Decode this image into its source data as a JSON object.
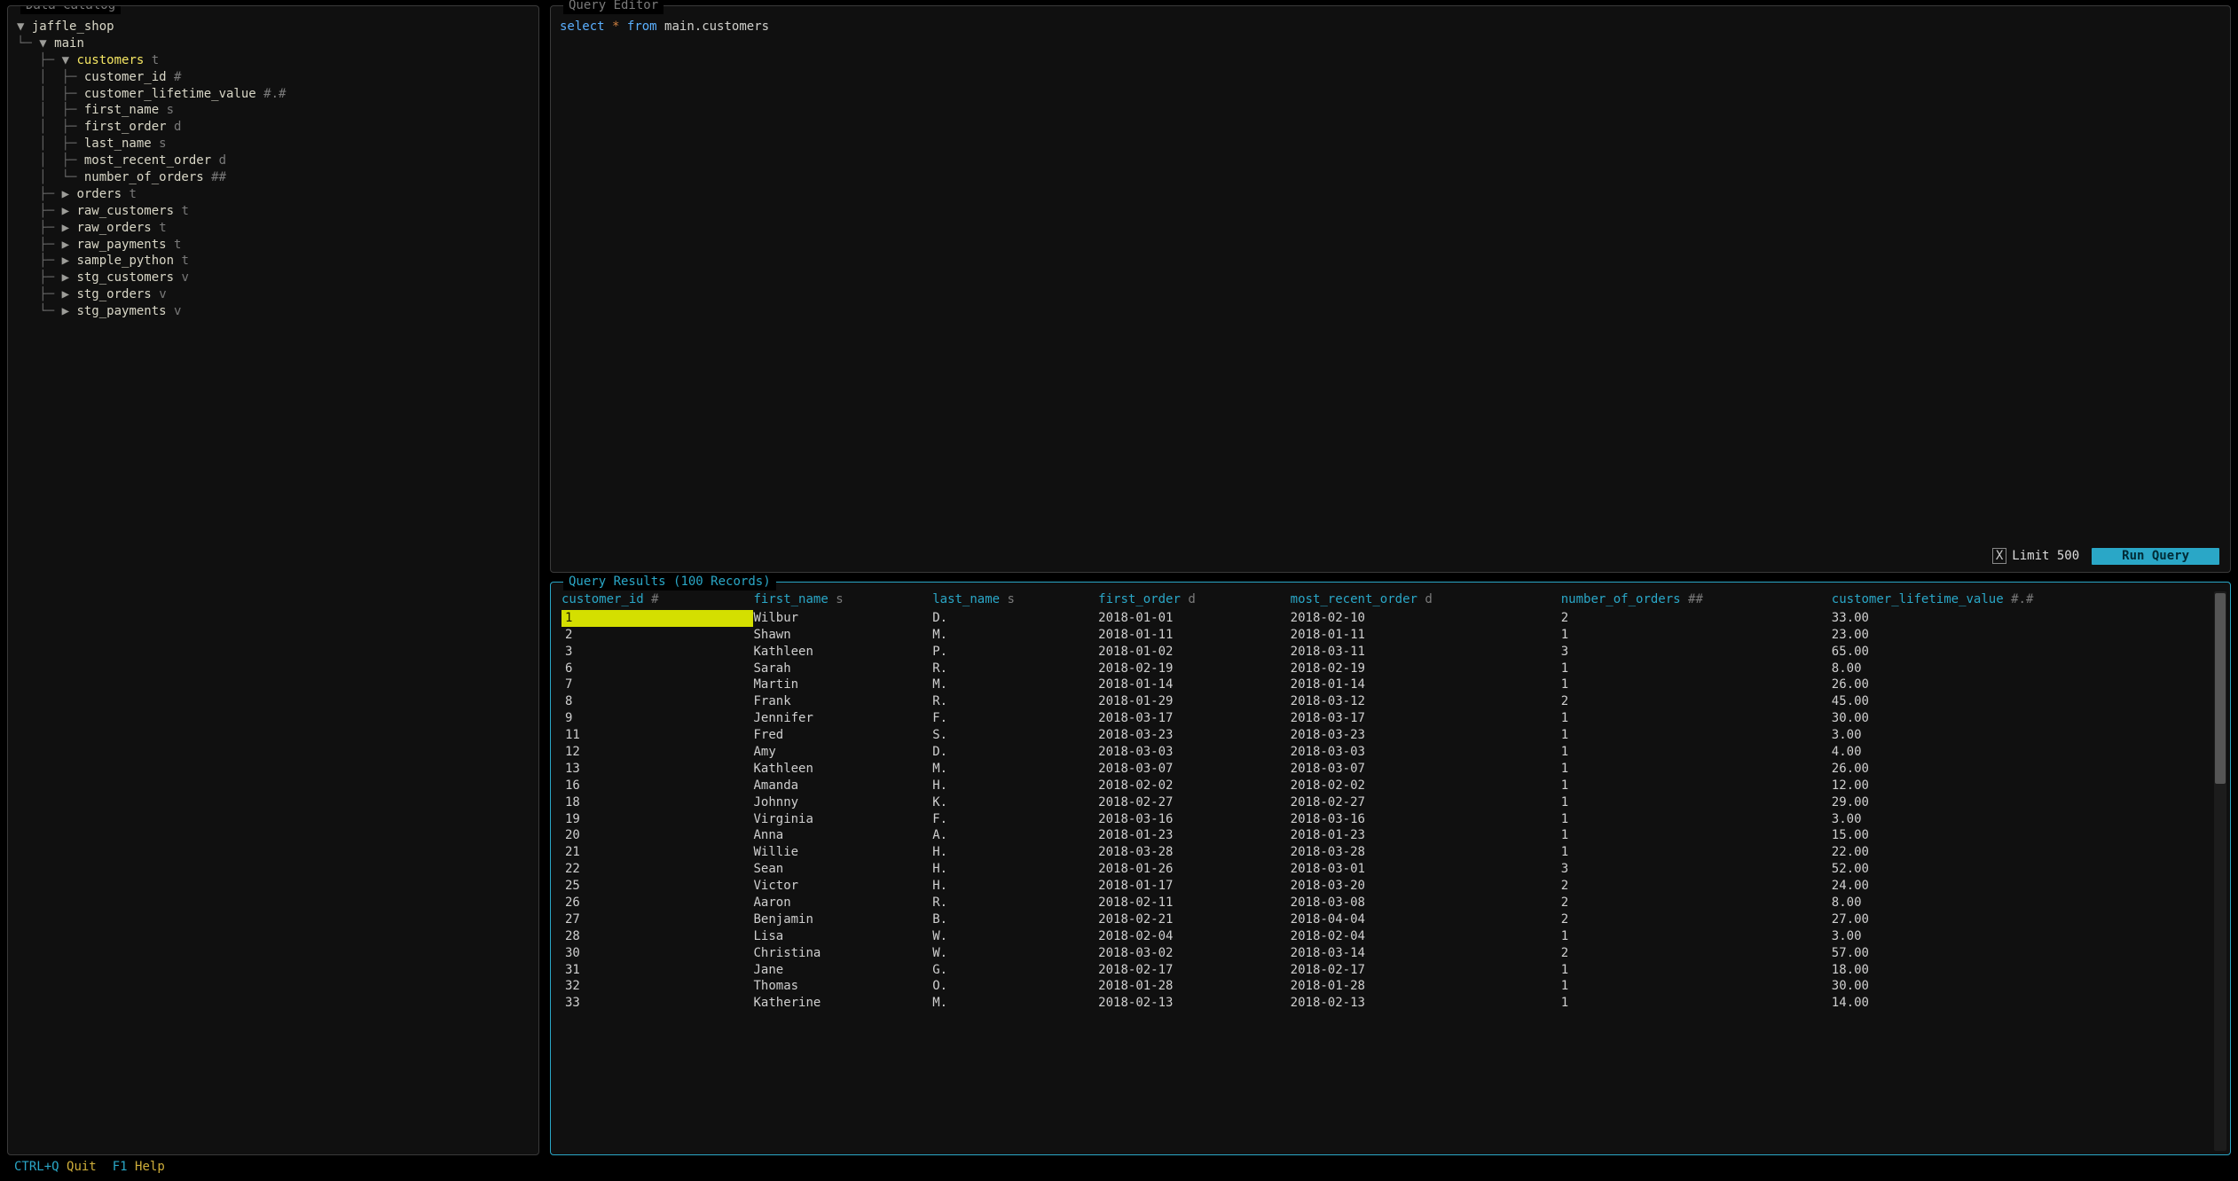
{
  "catalog": {
    "title": "Data Catalog",
    "root": {
      "name": "jaffle_shop",
      "expanded": true
    },
    "schema": {
      "name": "main",
      "expanded": true
    },
    "tables": [
      {
        "name": "customers",
        "type": "t",
        "expanded": true,
        "selected": true,
        "columns": [
          {
            "name": "customer_id",
            "type": "#"
          },
          {
            "name": "customer_lifetime_value",
            "type": "#.#"
          },
          {
            "name": "first_name",
            "type": "s"
          },
          {
            "name": "first_order",
            "type": "d"
          },
          {
            "name": "last_name",
            "type": "s"
          },
          {
            "name": "most_recent_order",
            "type": "d"
          },
          {
            "name": "number_of_orders",
            "type": "##"
          }
        ]
      },
      {
        "name": "orders",
        "type": "t",
        "expanded": false
      },
      {
        "name": "raw_customers",
        "type": "t",
        "expanded": false
      },
      {
        "name": "raw_orders",
        "type": "t",
        "expanded": false
      },
      {
        "name": "raw_payments",
        "type": "t",
        "expanded": false
      },
      {
        "name": "sample_python",
        "type": "t",
        "expanded": false
      },
      {
        "name": "stg_customers",
        "type": "v",
        "expanded": false
      },
      {
        "name": "stg_orders",
        "type": "v",
        "expanded": false
      },
      {
        "name": "stg_payments",
        "type": "v",
        "expanded": false
      }
    ]
  },
  "editor": {
    "title": "Query Editor",
    "sql_kw_select": "select",
    "sql_star": "*",
    "sql_kw_from": "from",
    "sql_ident": "main.customers",
    "limit_check": "X",
    "limit_label": "Limit 500",
    "run_label": "Run Query"
  },
  "results": {
    "title_prefix": "Query Results",
    "record_count": 100,
    "record_suffix": "Records",
    "columns": [
      {
        "name": "customer_id",
        "type": "#"
      },
      {
        "name": "first_name",
        "type": "s"
      },
      {
        "name": "last_name",
        "type": "s"
      },
      {
        "name": "first_order",
        "type": "d"
      },
      {
        "name": "most_recent_order",
        "type": "d"
      },
      {
        "name": "number_of_orders",
        "type": "##"
      },
      {
        "name": "customer_lifetime_value",
        "type": "#.#"
      }
    ],
    "rows": [
      [
        "1",
        "Wilbur",
        "D.",
        "2018-01-01",
        "2018-02-10",
        "2",
        "33.00"
      ],
      [
        "2",
        "Shawn",
        "M.",
        "2018-01-11",
        "2018-01-11",
        "1",
        "23.00"
      ],
      [
        "3",
        "Kathleen",
        "P.",
        "2018-01-02",
        "2018-03-11",
        "3",
        "65.00"
      ],
      [
        "6",
        "Sarah",
        "R.",
        "2018-02-19",
        "2018-02-19",
        "1",
        "8.00"
      ],
      [
        "7",
        "Martin",
        "M.",
        "2018-01-14",
        "2018-01-14",
        "1",
        "26.00"
      ],
      [
        "8",
        "Frank",
        "R.",
        "2018-01-29",
        "2018-03-12",
        "2",
        "45.00"
      ],
      [
        "9",
        "Jennifer",
        "F.",
        "2018-03-17",
        "2018-03-17",
        "1",
        "30.00"
      ],
      [
        "11",
        "Fred",
        "S.",
        "2018-03-23",
        "2018-03-23",
        "1",
        "3.00"
      ],
      [
        "12",
        "Amy",
        "D.",
        "2018-03-03",
        "2018-03-03",
        "1",
        "4.00"
      ],
      [
        "13",
        "Kathleen",
        "M.",
        "2018-03-07",
        "2018-03-07",
        "1",
        "26.00"
      ],
      [
        "16",
        "Amanda",
        "H.",
        "2018-02-02",
        "2018-02-02",
        "1",
        "12.00"
      ],
      [
        "18",
        "Johnny",
        "K.",
        "2018-02-27",
        "2018-02-27",
        "1",
        "29.00"
      ],
      [
        "19",
        "Virginia",
        "F.",
        "2018-03-16",
        "2018-03-16",
        "1",
        "3.00"
      ],
      [
        "20",
        "Anna",
        "A.",
        "2018-01-23",
        "2018-01-23",
        "1",
        "15.00"
      ],
      [
        "21",
        "Willie",
        "H.",
        "2018-03-28",
        "2018-03-28",
        "1",
        "22.00"
      ],
      [
        "22",
        "Sean",
        "H.",
        "2018-01-26",
        "2018-03-01",
        "3",
        "52.00"
      ],
      [
        "25",
        "Victor",
        "H.",
        "2018-01-17",
        "2018-03-20",
        "2",
        "24.00"
      ],
      [
        "26",
        "Aaron",
        "R.",
        "2018-02-11",
        "2018-03-08",
        "2",
        "8.00"
      ],
      [
        "27",
        "Benjamin",
        "B.",
        "2018-02-21",
        "2018-04-04",
        "2",
        "27.00"
      ],
      [
        "28",
        "Lisa",
        "W.",
        "2018-02-04",
        "2018-02-04",
        "1",
        "3.00"
      ],
      [
        "30",
        "Christina",
        "W.",
        "2018-03-02",
        "2018-03-14",
        "2",
        "57.00"
      ],
      [
        "31",
        "Jane",
        "G.",
        "2018-02-17",
        "2018-02-17",
        "1",
        "18.00"
      ],
      [
        "32",
        "Thomas",
        "O.",
        "2018-01-28",
        "2018-01-28",
        "1",
        "30.00"
      ],
      [
        "33",
        "Katherine",
        "M.",
        "2018-02-13",
        "2018-02-13",
        "1",
        "14.00"
      ]
    ],
    "selected_row": 0
  },
  "footer": {
    "items": [
      {
        "key": "CTRL+Q",
        "label": "Quit"
      },
      {
        "key": "F1",
        "label": "Help"
      }
    ]
  }
}
